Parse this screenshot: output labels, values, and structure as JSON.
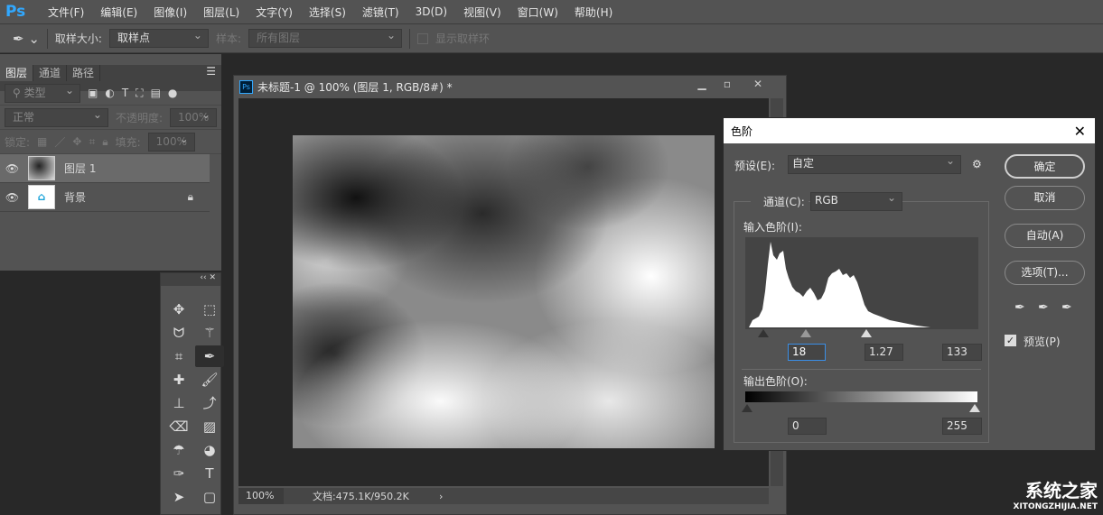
{
  "app": {
    "logo": "Ps"
  },
  "menu": [
    "文件(F)",
    "编辑(E)",
    "图像(I)",
    "图层(L)",
    "文字(Y)",
    "选择(S)",
    "滤镜(T)",
    "3D(D)",
    "视图(V)",
    "窗口(W)",
    "帮助(H)"
  ],
  "options": {
    "sample_size_label": "取样大小:",
    "sample_size": "取样点",
    "sample_label": "样本:",
    "sample": "所有图层",
    "show_ring": "显示取样环"
  },
  "layers_panel": {
    "tabs": [
      "图层",
      "通道",
      "路径"
    ],
    "filter": "类型",
    "blend": "正常",
    "opacity_label": "不透明度:",
    "opacity": "100%",
    "lock_label": "锁定:",
    "fill_label": "填充:",
    "fill": "100%",
    "layers": [
      {
        "name": "图层 1"
      },
      {
        "name": "背景"
      }
    ]
  },
  "document": {
    "title": "未标题-1 @ 100% (图层 1, RGB/8#) *",
    "zoom": "100%",
    "doc_info": "文档:475.1K/950.2K",
    "status_arrow": "›"
  },
  "levels": {
    "title": "色阶",
    "preset_label": "预设(E):",
    "preset": "自定",
    "channel_label": "通道(C):",
    "channel": "RGB",
    "input_label": "输入色阶(I):",
    "input_black": "18",
    "input_gamma": "1.27",
    "input_white": "133",
    "output_label": "输出色阶(O):",
    "output_black": "0",
    "output_white": "255",
    "ok": "确定",
    "cancel": "取消",
    "auto": "自动(A)",
    "options": "选项(T)...",
    "preview": "预览(P)",
    "preview_checked": true
  },
  "watermark": {
    "name": "系统之家",
    "url": "XITONGZHIJIA.NET"
  }
}
